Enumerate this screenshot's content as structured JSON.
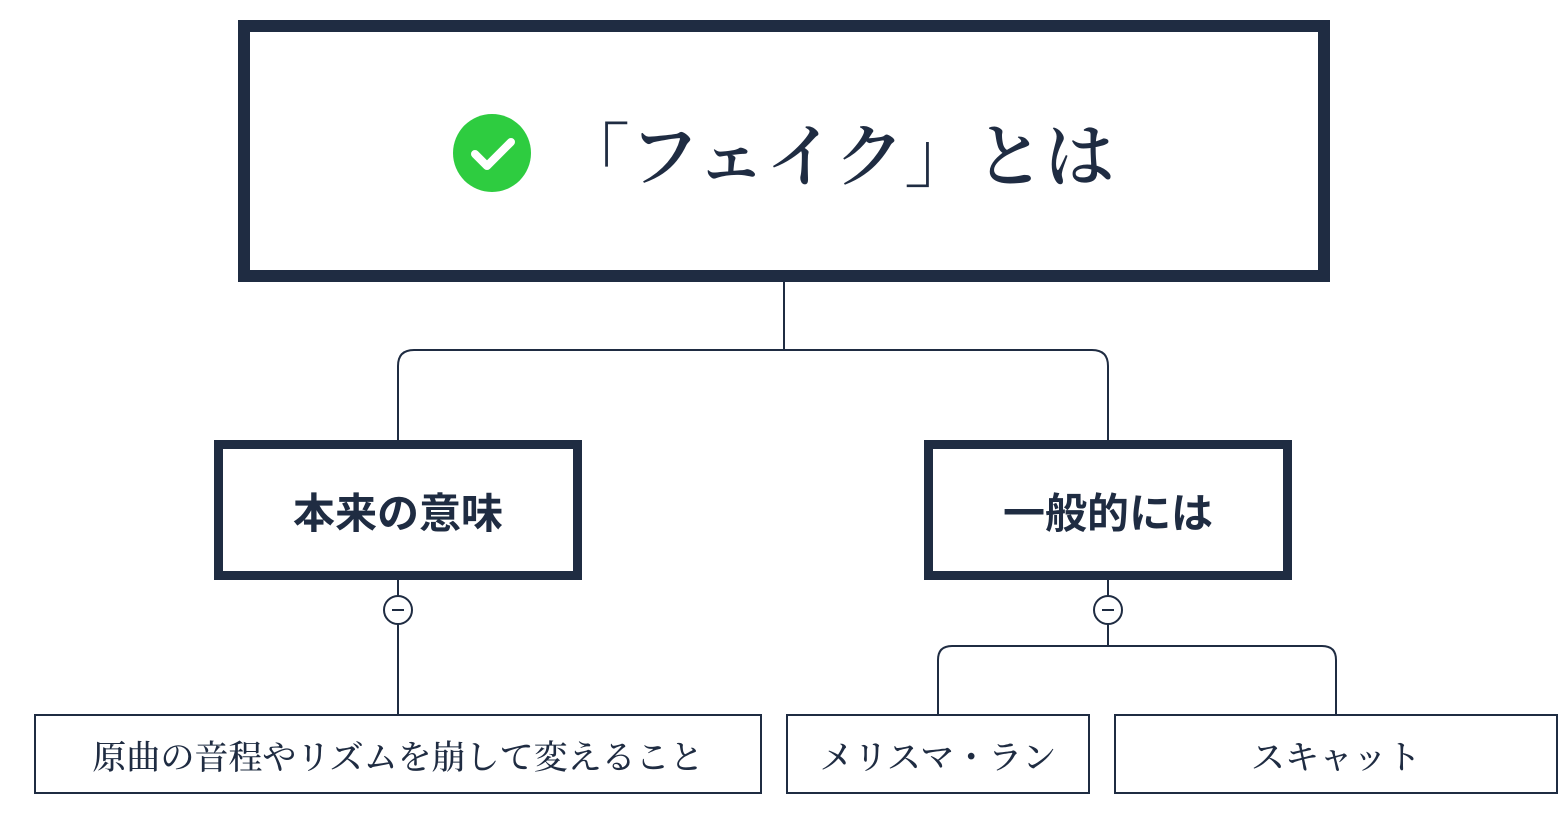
{
  "root": {
    "title": "「フェイク」とは",
    "icon": "check-circle"
  },
  "children": [
    {
      "title": "本来の意味",
      "leaves": [
        "原曲の音程やリズムを崩して変えること"
      ]
    },
    {
      "title": "一般的には",
      "leaves": [
        "メリスマ・ラン",
        "スキャット"
      ]
    }
  ],
  "colors": {
    "stroke": "#1f2c42",
    "accent": "#2ecc40"
  }
}
